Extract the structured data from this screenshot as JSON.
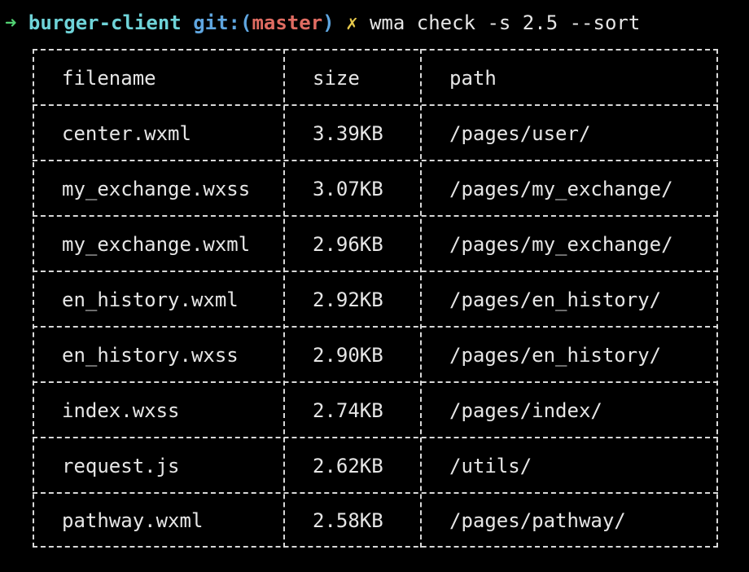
{
  "prompt": {
    "arrow": "➜",
    "directory": "burger-client",
    "git_prefix": "git:(",
    "branch": "master",
    "git_suffix": ")",
    "dirty_mark": "✗",
    "command": "wma check -s 2.5 --sort"
  },
  "table": {
    "headers": [
      "filename",
      "size",
      "path"
    ],
    "rows": [
      {
        "filename": "center.wxml",
        "size": "3.39KB",
        "path": "/pages/user/"
      },
      {
        "filename": "my_exchange.wxss",
        "size": "3.07KB",
        "path": "/pages/my_exchange/"
      },
      {
        "filename": "my_exchange.wxml",
        "size": "2.96KB",
        "path": "/pages/my_exchange/"
      },
      {
        "filename": "en_history.wxml",
        "size": "2.92KB",
        "path": "/pages/en_history/"
      },
      {
        "filename": "en_history.wxss",
        "size": "2.90KB",
        "path": "/pages/en_history/"
      },
      {
        "filename": "index.wxss",
        "size": "2.74KB",
        "path": "/pages/index/"
      },
      {
        "filename": "request.js",
        "size": "2.62KB",
        "path": "/utils/"
      },
      {
        "filename": "pathway.wxml",
        "size": "2.58KB",
        "path": "/pages/pathway/"
      }
    ]
  },
  "colors": {
    "background": "#000000",
    "arrow": "#52d273",
    "directory": "#6fd3d8",
    "git": "#5fa6e0",
    "branch": "#e06c62",
    "dirty_mark": "#e6c84b",
    "text": "#e6e6e6"
  }
}
